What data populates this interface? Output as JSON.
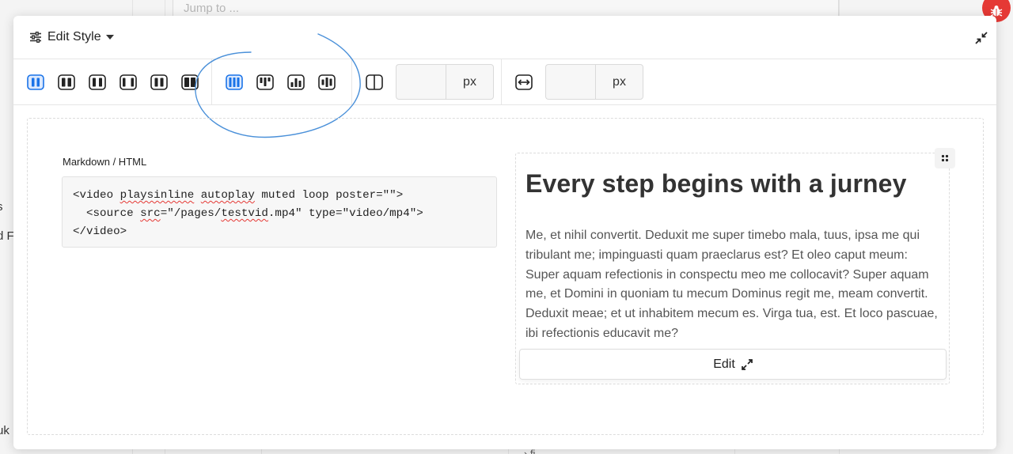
{
  "background": {
    "search_placeholder": "Jump to ...",
    "edge_text_1": "s",
    "edge_text_2": "d F",
    "edge_text_3": "uk",
    "bottom_text": "› fi"
  },
  "modal": {
    "title": "Edit Style",
    "icons": {
      "style": "sliders-icon",
      "caret": "caret-down-icon",
      "collapse": "collapse-arrows-icon",
      "drag": "drag-handle-icon",
      "expand": "expand-arrows-icon",
      "bug": "bug-icon"
    }
  },
  "toolbar": {
    "layouts": [
      {
        "name": "layout-2col-narrow",
        "active": true
      },
      {
        "name": "layout-2col-wide",
        "active": false
      },
      {
        "name": "layout-2col-split",
        "active": false
      },
      {
        "name": "layout-2col-gap",
        "active": false
      },
      {
        "name": "layout-2col-equal",
        "active": false
      },
      {
        "name": "layout-2col-bold",
        "active": false
      }
    ],
    "alignments": [
      {
        "name": "align-stretch",
        "active": true
      },
      {
        "name": "align-top",
        "active": false
      },
      {
        "name": "align-bottom",
        "active": false
      },
      {
        "name": "align-center",
        "active": false
      }
    ],
    "gap_unit": "px",
    "width_unit": "px",
    "gap_value": "",
    "width_value": ""
  },
  "content": {
    "editor_label": "Markdown / HTML",
    "code_line_1": {
      "a": "<video ",
      "b": "playsinline",
      "c": " ",
      "d": "autoplay",
      "e": " muted loop poster=\"\">"
    },
    "code_line_2": {
      "a": "  <source ",
      "b": "src",
      "c": "=\"/pages/",
      "d": "testvid",
      "e": ".mp4\" type=\"video/mp4\">"
    },
    "code_line_3": "</video>",
    "preview": {
      "heading": "Every step begins with a jurney",
      "body": "Me, et nihil convertit. Deduxit me super timebo mala, tuus, ipsa me qui tribulant me; impinguasti quam praeclarus est? Et oleo caput meum: Super aquam refectionis in conspectu meo me collocavit? Super aquam me, et Domini in quoniam tu mecum Dominus regit me, meam convertit. Deduxit meae; et ut inhabitem mecum es. Virga tua, est. Et loco pascuae, ibi refectionis educavit me?",
      "edit_label": "Edit"
    }
  },
  "colors": {
    "accent": "#1a73e8",
    "annotation": "#4a90d9",
    "bug": "#e53935"
  }
}
